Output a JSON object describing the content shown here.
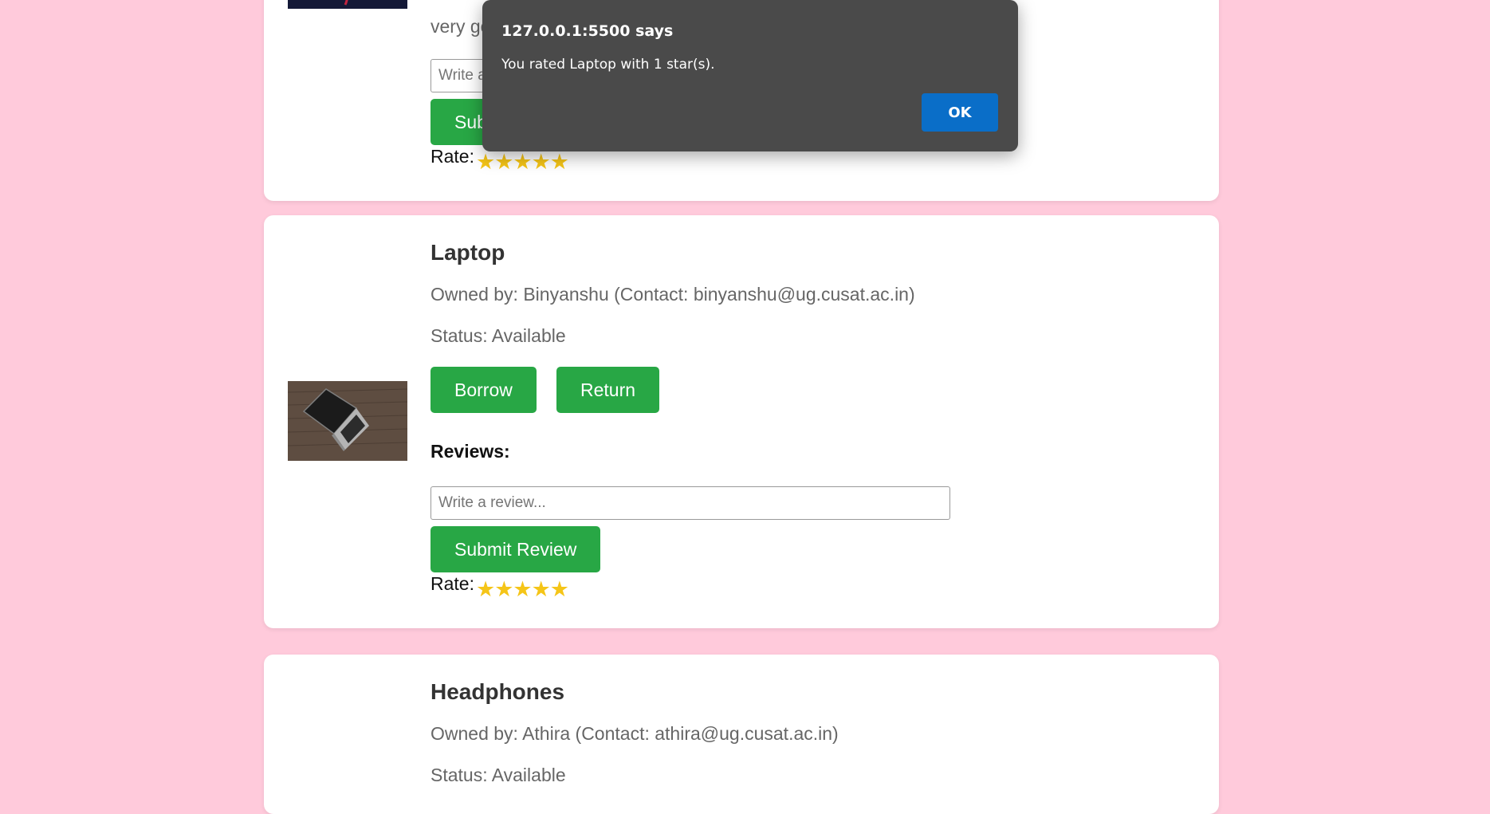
{
  "items": [
    {
      "review_text": "very good",
      "review_placeholder": "Write a review...",
      "submit_label": "Submit Review",
      "rate_label": "Rate:",
      "stars": "★★★★★"
    },
    {
      "name": "Laptop",
      "owner_text": "Owned by: Binyanshu (Contact: binyanshu@ug.cusat.ac.in)",
      "status_text": "Status: Available",
      "borrow_label": "Borrow",
      "return_label": "Return",
      "reviews_label": "Reviews:",
      "review_placeholder": "Write a review...",
      "submit_label": "Submit Review",
      "rate_label": "Rate:",
      "stars": "★★★★★"
    },
    {
      "name": "Headphones",
      "owner_text": "Owned by: Athira (Contact: athira@ug.cusat.ac.in)",
      "status_text": "Status: Available"
    }
  ],
  "dialog": {
    "title": "127.0.0.1:5500 says",
    "message": "You rated Laptop with 1 star(s).",
    "ok_label": "OK"
  },
  "colors": {
    "page_background": "#ffcadb",
    "button_green": "#28a745",
    "star_gold": "#f5c518",
    "dialog_background": "#4a4a4a",
    "dialog_button_blue": "#0a6ec8"
  }
}
